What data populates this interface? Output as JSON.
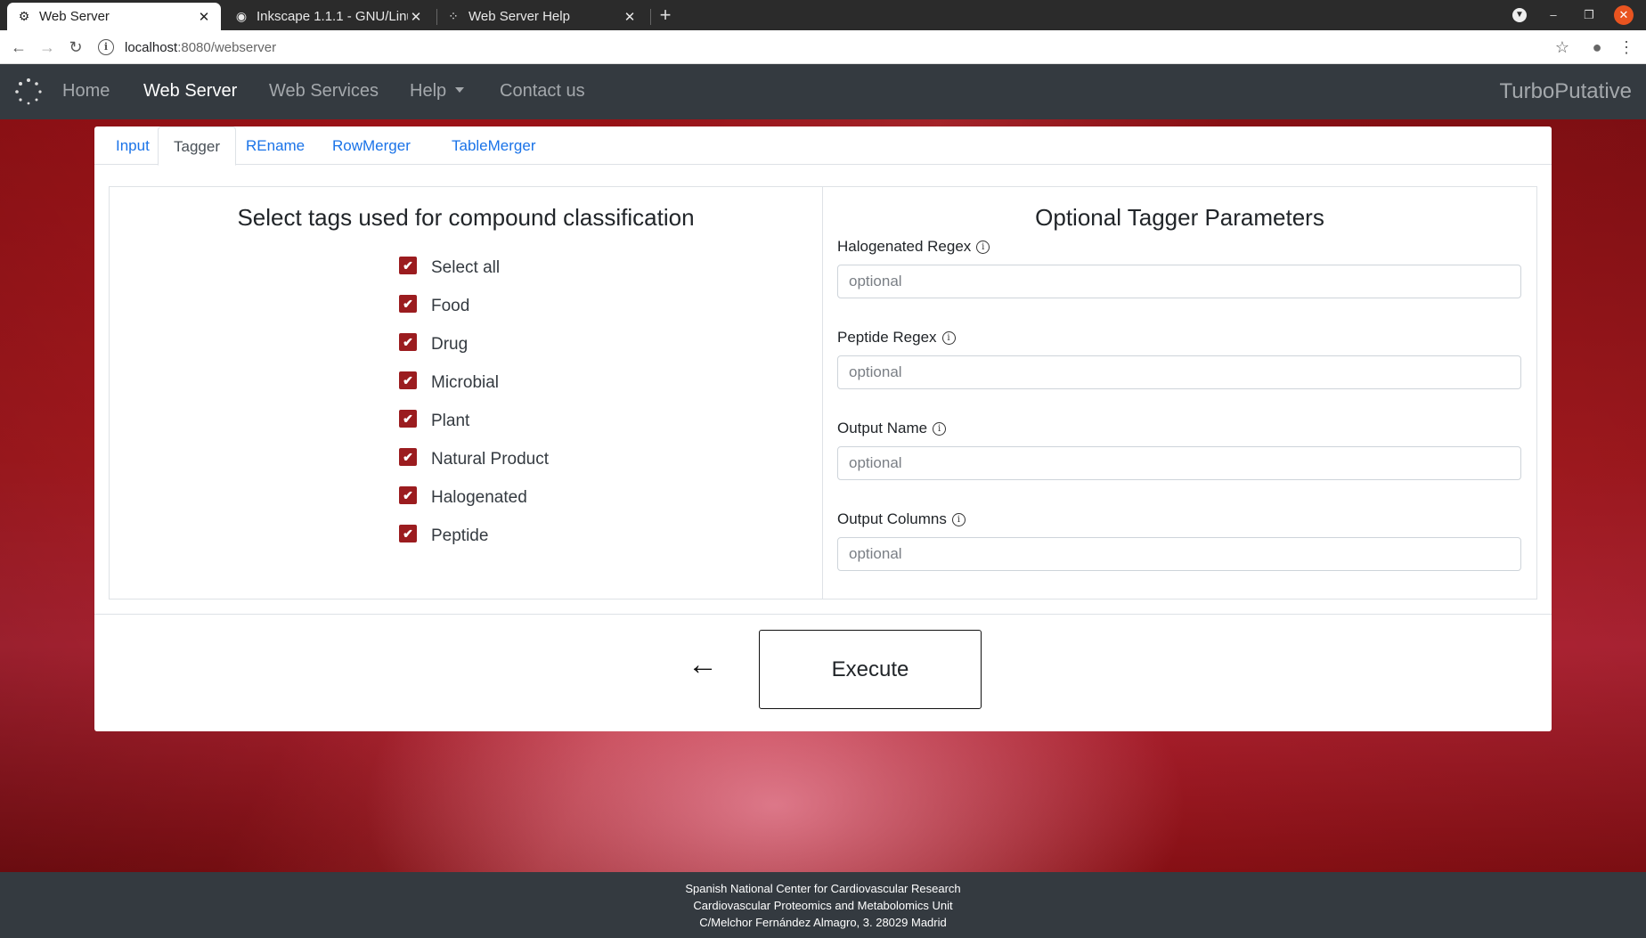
{
  "browser": {
    "tabs": [
      {
        "title": "Web Server",
        "favicon": "gear-icon"
      },
      {
        "title": "Inkscape 1.1.1 - GNU/Linux",
        "favicon": "github-icon"
      },
      {
        "title": "Web Server Help",
        "favicon": "spinner-icon"
      }
    ],
    "url_host": "localhost",
    "url_path": ":8080/webserver"
  },
  "nav": {
    "items": [
      "Home",
      "Web Server",
      "Web Services",
      "Help",
      "Contact us"
    ],
    "active": "Web Server",
    "brand": "TurboPutative"
  },
  "card_tabs": [
    "Input",
    "Tagger",
    "REname",
    "RowMerger",
    "TableMerger"
  ],
  "active_tab": "Tagger",
  "left_panel": {
    "title": "Select tags used for compound classification",
    "checks": [
      {
        "label": "Select all",
        "checked": true
      },
      {
        "label": "Food",
        "checked": true
      },
      {
        "label": "Drug",
        "checked": true
      },
      {
        "label": "Microbial",
        "checked": true
      },
      {
        "label": "Plant",
        "checked": true
      },
      {
        "label": "Natural Product",
        "checked": true
      },
      {
        "label": "Halogenated",
        "checked": true
      },
      {
        "label": "Peptide",
        "checked": true
      }
    ]
  },
  "right_panel": {
    "title": "Optional Tagger Parameters",
    "fields": [
      {
        "label": "Halogenated Regex",
        "placeholder": "optional",
        "value": ""
      },
      {
        "label": "Peptide Regex",
        "placeholder": "optional",
        "value": ""
      },
      {
        "label": "Output Name",
        "placeholder": "optional",
        "value": ""
      },
      {
        "label": "Output Columns",
        "placeholder": "optional",
        "value": ""
      }
    ]
  },
  "actions": {
    "back": "←",
    "execute": "Execute"
  },
  "footer": {
    "lines": [
      "Spanish National Center for Cardiovascular Research",
      "Cardiovascular Proteomics and Metabolomics Unit",
      "C/Melchor Fernández Almagro, 3. 28029 Madrid"
    ]
  },
  "colors": {
    "navbar": "#343a40",
    "accent_link": "#1a73e8",
    "checkbox": "#9b1c1f",
    "background_red": "#b81c22"
  }
}
